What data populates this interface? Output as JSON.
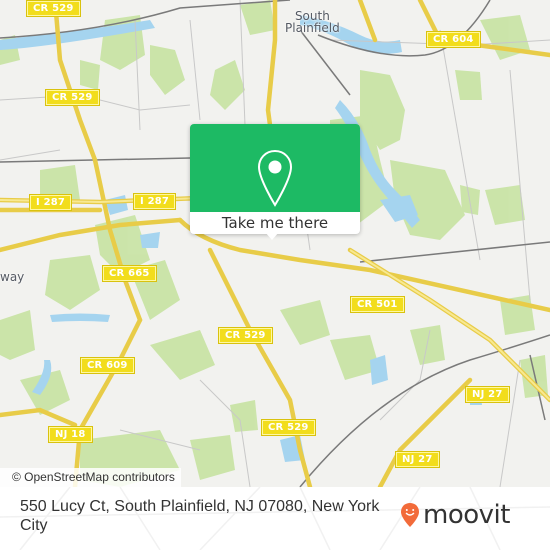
{
  "map": {
    "place_labels": [
      {
        "id": "south-plainfield",
        "lines": [
          "South",
          "Plainfield"
        ]
      },
      {
        "id": "edison-partial",
        "lines": [
          "way"
        ]
      }
    ],
    "road_shields": [
      {
        "id": "cr529-a",
        "label": "CR 529"
      },
      {
        "id": "cr529-b",
        "label": "CR 529"
      },
      {
        "id": "cr604",
        "label": "CR 604"
      },
      {
        "id": "i287-a",
        "label": "I 287"
      },
      {
        "id": "i287-b",
        "label": "I 287"
      },
      {
        "id": "cr665",
        "label": "CR 665"
      },
      {
        "id": "cr501",
        "label": "CR 501"
      },
      {
        "id": "cr529-c",
        "label": "CR 529"
      },
      {
        "id": "cr609",
        "label": "CR 609"
      },
      {
        "id": "nj27-a",
        "label": "NJ 27"
      },
      {
        "id": "cr529-d",
        "label": "CR 529"
      },
      {
        "id": "nj18",
        "label": "NJ 18"
      },
      {
        "id": "nj27-b",
        "label": "NJ 27"
      }
    ],
    "attribution": "© OpenStreetMap contributors",
    "colors": {
      "land": "#f2f2ef",
      "park": "#c9e4a6",
      "water": "#a5d4ef",
      "road_major": "#f2dd5a",
      "rail": "#7a7a7a"
    }
  },
  "popup": {
    "button_label": "Take me there",
    "accent_color": "#1dba64",
    "icon": "map-pin-icon"
  },
  "footer": {
    "address": "550 Lucy Ct, South Plainfield, NJ 07080, New York City",
    "brand": "moovit",
    "brand_color": "#f26b3a"
  }
}
